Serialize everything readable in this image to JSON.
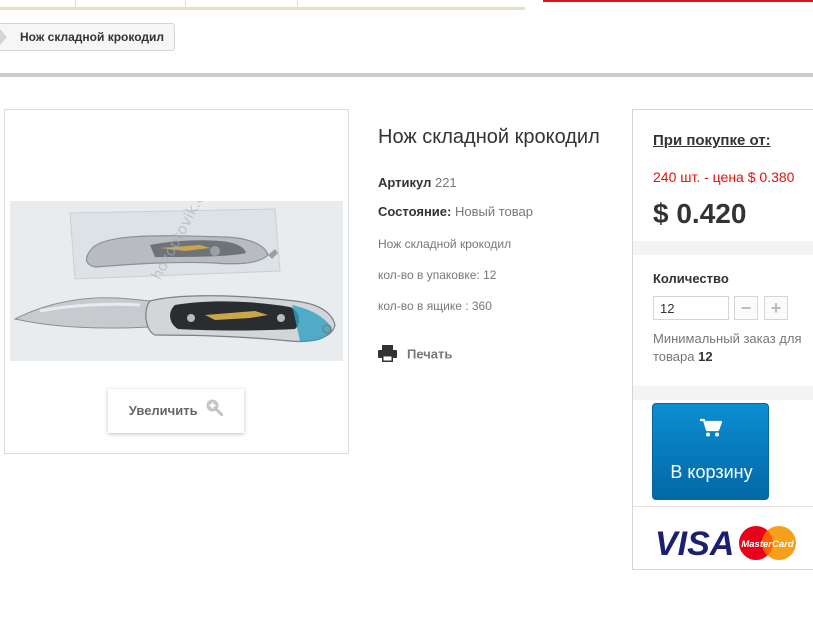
{
  "breadcrumb": {
    "current": "Нож складной крокодил"
  },
  "image": {
    "watermark": "hozoptovik.com",
    "zoom_label": "Увеличить"
  },
  "product": {
    "title": "Нож складной крокодил",
    "sku_label": "Артикул",
    "sku_value": "221",
    "condition_label": "Состояние:",
    "condition_value": "Новый товар",
    "description": "Нож складной крокодил",
    "pack_qty": "кол-во в упаковке: 12",
    "box_qty": "кол-во в ящике : 360",
    "print_label": "Печать"
  },
  "buy_box": {
    "price_title": "При покупке от:",
    "discount": "240 шт. - цена $ 0.380",
    "price": "$ 0.420",
    "quantity_label": "Количество",
    "quantity_value": "12",
    "min_order_text": "Минимальный заказ для товара",
    "min_order_qty": "12",
    "cart_label": "В корзину",
    "cards": [
      "VISA",
      "MasterCard"
    ]
  },
  "colors": {
    "accent_red": "#e3110c",
    "cart_blue": "#0b8ed2"
  },
  "icons": [
    "zoom-in-icon",
    "printer-icon",
    "cart-icon",
    "minus-icon",
    "plus-icon"
  ]
}
